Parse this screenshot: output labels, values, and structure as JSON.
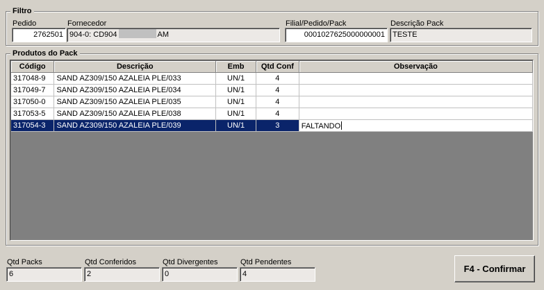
{
  "filtro": {
    "title": "Filtro",
    "pedido_label": "Pedido",
    "pedido_value": "2762501",
    "fornecedor_label": "Fornecedor",
    "fornecedor_value_prefix": "904-0: CD904",
    "fornecedor_value_suffix": "AM",
    "filial_label": "Filial/Pedido/Pack",
    "filial_value": "0001027625000000001",
    "descricao_pack_label": "Descrição Pack",
    "descricao_pack_value": "TESTE"
  },
  "produtos": {
    "title": "Produtos do Pack",
    "columns": [
      "Código",
      "Descrição",
      "Emb",
      "Qtd Conf",
      "Observação"
    ],
    "rows": [
      {
        "codigo": "317048-9",
        "descricao": "SAND AZ309/150 AZALEIA PLE/033",
        "emb": "UN/1",
        "qtd": "4",
        "obs": ""
      },
      {
        "codigo": "317049-7",
        "descricao": "SAND AZ309/150 AZALEIA PLE/034",
        "emb": "UN/1",
        "qtd": "4",
        "obs": ""
      },
      {
        "codigo": "317050-0",
        "descricao": "SAND AZ309/150 AZALEIA PLE/035",
        "emb": "UN/1",
        "qtd": "4",
        "obs": ""
      },
      {
        "codigo": "317053-5",
        "descricao": "SAND AZ309/150 AZALEIA PLE/038",
        "emb": "UN/1",
        "qtd": "4",
        "obs": ""
      },
      {
        "codigo": "317054-3",
        "descricao": "SAND AZ309/150 AZALEIA PLE/039",
        "emb": "UN/1",
        "qtd": "3",
        "obs": "FALTANDO"
      }
    ]
  },
  "footer": {
    "qtd_packs_label": "Qtd Packs",
    "qtd_packs_value": "6",
    "qtd_conferidos_label": "Qtd Conferidos",
    "qtd_conferidos_value": "2",
    "qtd_divergentes_label": "Qtd Divergentes",
    "qtd_divergentes_value": "0",
    "qtd_pendentes_label": "Qtd Pendentes",
    "qtd_pendentes_value": "4",
    "confirm_label": "F4 - Confirmar"
  },
  "colors": {
    "window_bg": "#d4d0c8",
    "selection_bg": "#0a246a",
    "grid_empty_bg": "#808080"
  }
}
